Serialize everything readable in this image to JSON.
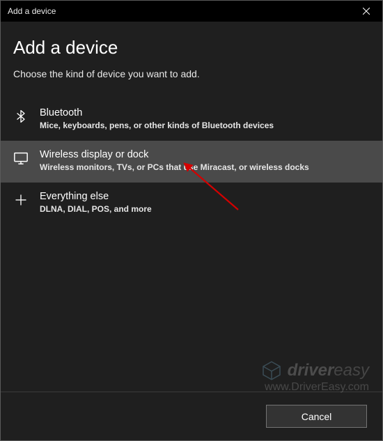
{
  "titlebar": {
    "title": "Add a device"
  },
  "heading": "Add a device",
  "subheading": "Choose the kind of device you want to add.",
  "options": {
    "bluetooth": {
      "title": "Bluetooth",
      "desc": "Mice, keyboards, pens, or other kinds of Bluetooth devices"
    },
    "wireless": {
      "title": "Wireless display or dock",
      "desc": "Wireless monitors, TVs, or PCs that use Miracast, or wireless docks"
    },
    "everything": {
      "title": "Everything else",
      "desc": "DLNA, DIAL, POS, and more"
    }
  },
  "footer": {
    "cancel": "Cancel"
  },
  "watermark": {
    "brand_part1": "driver",
    "brand_part2": "easy",
    "url": "www.DriverEasy.com"
  }
}
